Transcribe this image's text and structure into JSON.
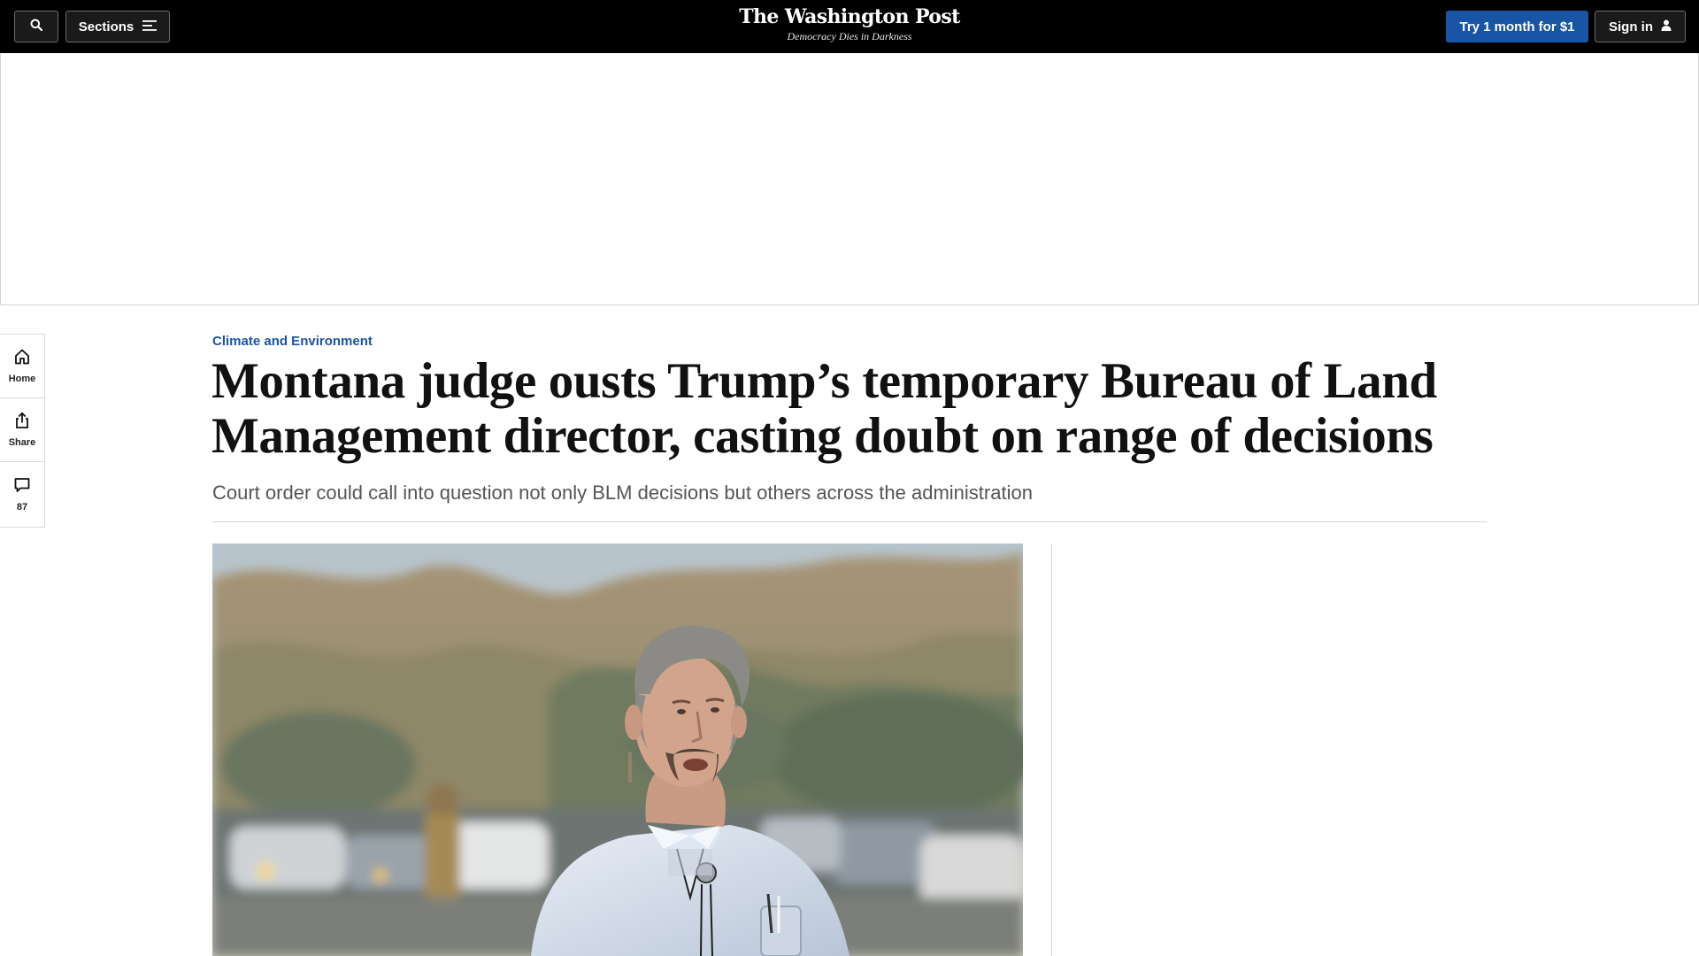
{
  "nav": {
    "search_icon": "search-icon",
    "sections_label": "Sections",
    "sections_icon": "menu-icon",
    "subscribe_label": "Try 1 month for $1",
    "signin_label": "Sign in",
    "signin_icon": "user-icon"
  },
  "masthead": {
    "logo": "The Washington Post",
    "tagline": "Democracy Dies in Darkness"
  },
  "rail": {
    "home_label": "Home",
    "share_label": "Share",
    "comments_count": "87"
  },
  "article": {
    "kicker": "Climate and Environment",
    "headline": "Montana judge ousts Trump’s temporary Bureau of Land Management director, casting doubt on range of decisions",
    "dek": "Court order could call into question not only BLM decisions but others across the administration"
  },
  "colors": {
    "nav_bg": "#000000",
    "accent_blue": "#1955a5",
    "kicker_blue": "#1955a5"
  }
}
